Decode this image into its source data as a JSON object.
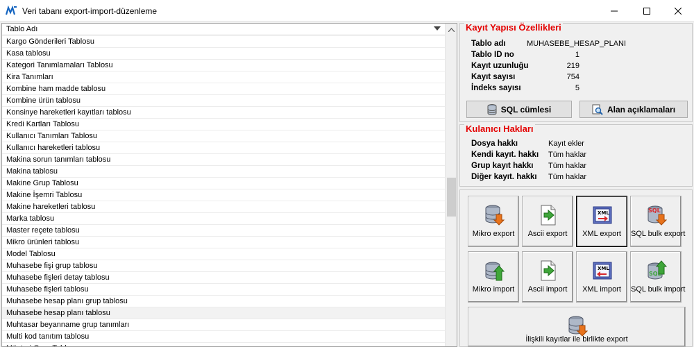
{
  "window": {
    "title": "Veri tabanı export-import-düzenleme"
  },
  "list": {
    "column_header": "Tablo Adı",
    "selected_index": 23,
    "rows": [
      "Kargo Gönderileri Tablosu",
      "Kasa tablosu",
      "Kategori Tanımlamaları Tablosu",
      "Kira Tanımları",
      "Kombine ham madde tablosu",
      "Kombine ürün tablosu",
      "Konsinye hareketleri kayıtları tablosu",
      "Kredi Kartları Tablosu",
      "Kullanıcı Tanımları Tablosu",
      "Kullanıcı hareketleri tablosu",
      "Makina sorun tanımları tablosu",
      "Makina tablosu",
      "Makine Grup Tablosu",
      "Makine İşemri Tablosu",
      "Makine hareketleri tablosu",
      "Marka tablosu",
      "Master reçete tablosu",
      "Mikro ürünleri tablosu",
      "Model Tablosu",
      "Muhasebe fişi grup tablosu",
      "Muhasebe fişleri detay tablosu",
      "Muhasebe fişleri tablosu",
      "Muhasebe hesap planı grup tablosu",
      "Muhasebe hesap planı tablosu",
      "Muhtasar beyanname grup tanımları",
      "Multi kod tanıtım tablosu",
      "Müşteri Grup Tablosu"
    ]
  },
  "record_props": {
    "title": "Kayıt Yapısı Özellikleri",
    "table_name_label": "Tablo adı",
    "table_name_value": "MUHASEBE_HESAP_PLANI",
    "table_id_label": "Tablo ID no",
    "table_id_value": "1",
    "record_length_label": "Kayıt uzunluğu",
    "record_length_value": "219",
    "record_count_label": "Kayıt sayısı",
    "record_count_value": "754",
    "index_count_label": "İndeks sayısı",
    "index_count_value": "5",
    "sql_button": "SQL cümlesi",
    "fields_button": "Alan açıklamaları"
  },
  "user_rights": {
    "title": "Kulanıcı Hakları",
    "file_right_label": "Dosya hakkı",
    "file_right_value": "Kayıt ekler",
    "own_record_label": "Kendi kayıt. hakkı",
    "own_record_value": "Tüm haklar",
    "group_record_label": "Grup kayıt hakkı",
    "group_record_value": "Tüm haklar",
    "other_record_label": "Diğer kayıt. hakkı",
    "other_record_value": "Tüm haklar"
  },
  "actions": {
    "mikro_export": "Mikro export",
    "ascii_export": "Ascii export",
    "xml_export": "XML export",
    "sql_bulk_export": "SQL bulk export",
    "mikro_import": "Mikro import",
    "ascii_import": "Ascii import",
    "xml_import": "XML import",
    "sql_bulk_import": "SQL bulk import",
    "related_export": "İlişkili kayıtlar ile birlikte export"
  },
  "icons": {
    "db": "database-icon",
    "file": "document-arrow-icon",
    "xml": "xml-icon",
    "sql": "sql-icon"
  },
  "colors": {
    "group_title": "#e40000",
    "arrow_orange": "#e8731c",
    "arrow_green": "#3fa63a"
  }
}
